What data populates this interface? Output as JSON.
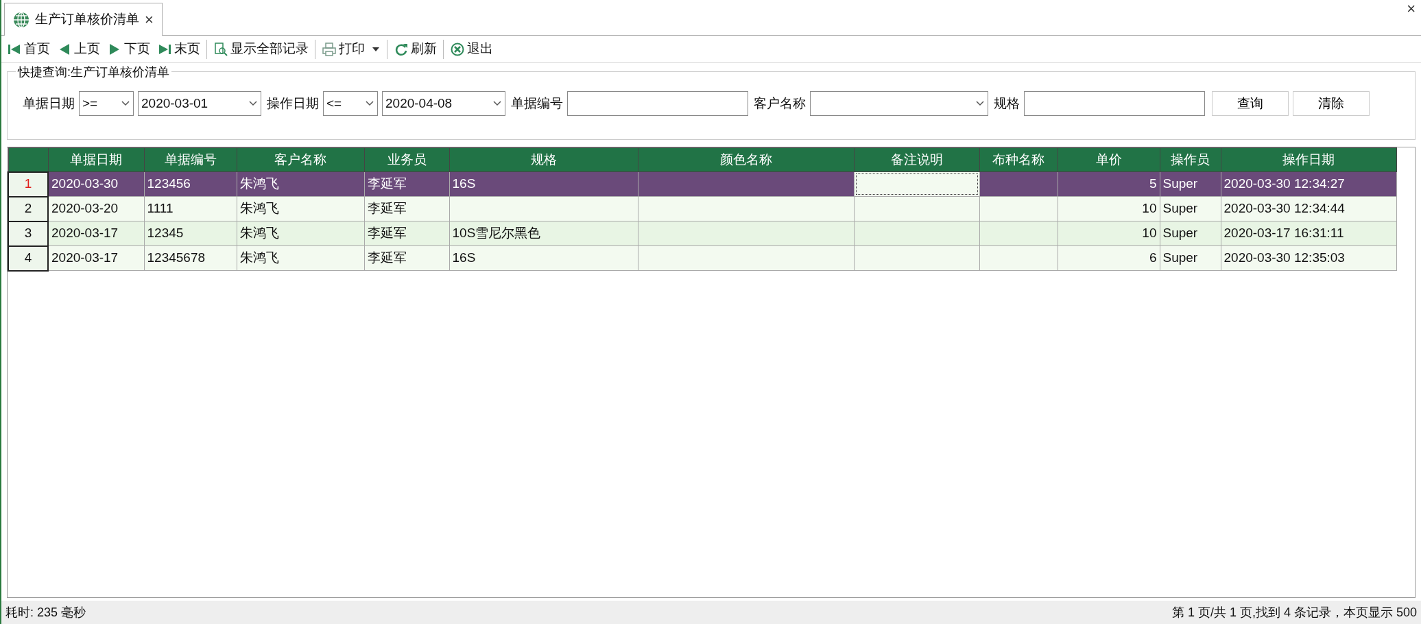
{
  "tabs": [
    {
      "title": "生产订单核价清单",
      "close": "×",
      "selected": true
    }
  ],
  "window_close": "×",
  "toolbar": [
    {
      "kind": "first",
      "label": "首页"
    },
    {
      "kind": "prev",
      "label": "上页"
    },
    {
      "kind": "next",
      "label": "下页"
    },
    {
      "kind": "last",
      "label": "末页"
    },
    {
      "kind": "separator"
    },
    {
      "kind": "showall",
      "label": "显示全部记录"
    },
    {
      "kind": "separator"
    },
    {
      "kind": "print",
      "label": "打印",
      "dropdown": true
    },
    {
      "kind": "separator"
    },
    {
      "kind": "refresh",
      "label": "刷新"
    },
    {
      "kind": "separator"
    },
    {
      "kind": "exit",
      "label": "退出"
    }
  ],
  "quick_query": {
    "title": "快捷查询:生产订单核价清单",
    "filters": [
      {
        "kind": "date",
        "label": "单据日期",
        "operator": ">=",
        "value": "2020-03-01"
      },
      {
        "kind": "date",
        "label": "操作日期",
        "operator": "<=",
        "value": "2020-04-08"
      },
      {
        "kind": "text",
        "label": "单据编号"
      },
      {
        "kind": "combo",
        "label": "客户名称"
      },
      {
        "kind": "text",
        "label": "规格"
      }
    ],
    "buttons": [
      "查询",
      "清除"
    ]
  },
  "table": {
    "columns": [
      {
        "label": "单据日期",
        "kind": "text"
      },
      {
        "label": "单据编号",
        "kind": "text"
      },
      {
        "label": "客户名称",
        "kind": "text"
      },
      {
        "label": "业务员",
        "kind": "text"
      },
      {
        "label": "规格",
        "kind": "text"
      },
      {
        "label": "颜色名称",
        "kind": "text"
      },
      {
        "label": "备注说明",
        "kind": "memo"
      },
      {
        "label": "布种名称",
        "kind": "text"
      },
      {
        "label": "单价",
        "kind": "number"
      },
      {
        "label": "操作员",
        "kind": "text"
      },
      {
        "label": "操作日期",
        "kind": "text"
      }
    ],
    "rows": [
      {
        "number": "1",
        "selected": true,
        "editing": true,
        "cells": [
          "2020-03-30",
          "123456",
          "朱鸿飞",
          "李延军",
          "16S",
          "",
          "",
          "",
          "5",
          "Super",
          "2020-03-30 12:34:27"
        ]
      },
      {
        "number": "2",
        "selected": false,
        "editing": false,
        "cells": [
          "2020-03-20",
          "1111",
          "朱鸿飞",
          "李延军",
          "",
          "",
          "",
          "",
          "10",
          "Super",
          "2020-03-30 12:34:44"
        ]
      },
      {
        "number": "3",
        "selected": false,
        "editing": false,
        "cells": [
          "2020-03-17",
          "12345",
          "朱鸿飞",
          "李延军",
          "10S雪尼尔黑色",
          "",
          "",
          "",
          "10",
          "Super",
          "2020-03-17 16:31:11"
        ]
      },
      {
        "number": "4",
        "selected": false,
        "editing": false,
        "cells": [
          "2020-03-17",
          "12345678",
          "朱鸿飞",
          "李延军",
          "16S",
          "",
          "",
          "",
          "6",
          "Super",
          "2020-03-30 12:35:03"
        ]
      }
    ]
  },
  "status_bar": {
    "left": "耗时: 235 毫秒",
    "right": "第 1 页/共 1 页,找到 4 条记录，本页显示 500"
  }
}
